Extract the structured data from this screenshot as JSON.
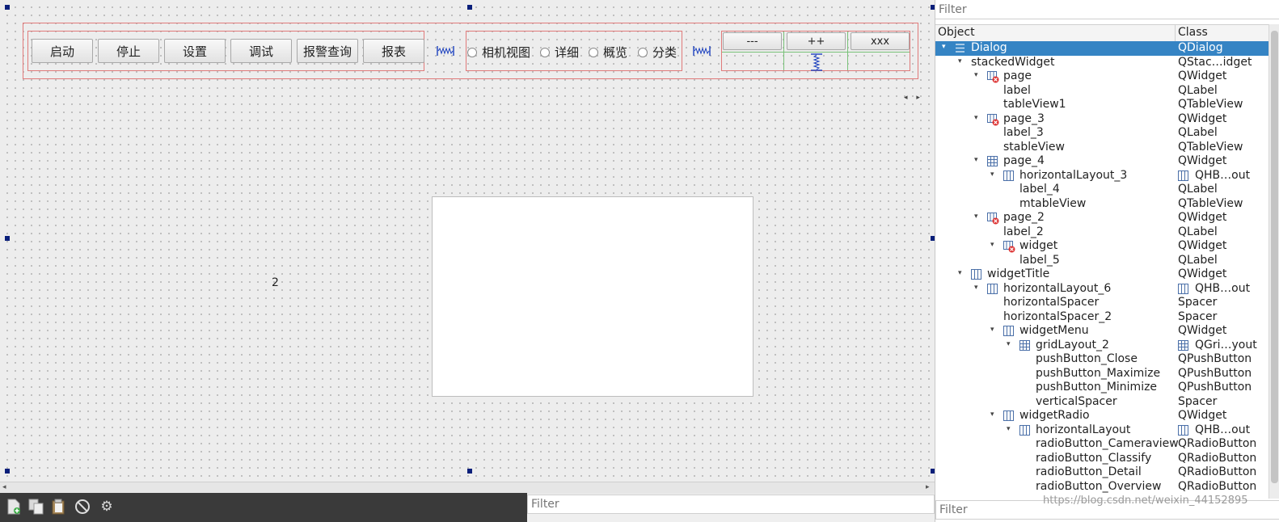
{
  "canvas": {
    "buttons": [
      "启动",
      "停止",
      "设置",
      "调试",
      "报警查询",
      "报表"
    ],
    "radios": [
      "相机视图",
      "详细",
      "概览",
      "分类"
    ],
    "window_buttons": [
      "---",
      "++",
      "xxx"
    ],
    "page_label": "2",
    "page_arrows": "◂ ▸"
  },
  "toolbar": {
    "icons": [
      "new-form-icon",
      "copy-icon",
      "paste-icon",
      "forbidden-icon",
      "gear-icon"
    ],
    "filter_placeholder": "Filter"
  },
  "inspector": {
    "filter_placeholder": "Filter",
    "bottom_filter_placeholder": "Filter",
    "header_object": "Object",
    "header_class": "Class",
    "rows": [
      {
        "name": "Dialog",
        "class": "QDialog",
        "level": 0,
        "expanded": true,
        "icon": "dialog-icon",
        "selected": true
      },
      {
        "name": "stackedWidget",
        "class": "QStac…idget",
        "level": 1,
        "expanded": true,
        "icon": ""
      },
      {
        "name": "page",
        "class": "QWidget",
        "level": 2,
        "expanded": true,
        "icon": "broken-layout-icon"
      },
      {
        "name": "label",
        "class": "QLabel",
        "level": 3,
        "icon": ""
      },
      {
        "name": "tableView1",
        "class": "QTableView",
        "level": 3,
        "icon": ""
      },
      {
        "name": "page_3",
        "class": "QWidget",
        "level": 2,
        "expanded": true,
        "icon": "broken-layout-icon"
      },
      {
        "name": "label_3",
        "class": "QLabel",
        "level": 3,
        "icon": ""
      },
      {
        "name": "stableView",
        "class": "QTableView",
        "level": 3,
        "icon": ""
      },
      {
        "name": "page_4",
        "class": "QWidget",
        "level": 2,
        "expanded": true,
        "icon": "grid-layout-icon"
      },
      {
        "name": "horizontalLayout_3",
        "class": "QHB…out",
        "level": 3,
        "expanded": true,
        "icon": "hbox-layout-icon",
        "class_icon": "hbox-layout-icon"
      },
      {
        "name": "label_4",
        "class": "QLabel",
        "level": 4,
        "icon": ""
      },
      {
        "name": "mtableView",
        "class": "QTableView",
        "level": 4,
        "icon": ""
      },
      {
        "name": "page_2",
        "class": "QWidget",
        "level": 2,
        "expanded": true,
        "icon": "broken-layout-icon"
      },
      {
        "name": "label_2",
        "class": "QLabel",
        "level": 3,
        "icon": ""
      },
      {
        "name": "widget",
        "class": "QWidget",
        "level": 3,
        "expanded": true,
        "icon": "broken-layout-icon"
      },
      {
        "name": "label_5",
        "class": "QLabel",
        "level": 4,
        "icon": ""
      },
      {
        "name": "widgetTitle",
        "class": "QWidget",
        "level": 1,
        "expanded": true,
        "icon": "hbox-layout-icon"
      },
      {
        "name": "horizontalLayout_6",
        "class": "QHB…out",
        "level": 2,
        "expanded": true,
        "icon": "hbox-layout-icon",
        "class_icon": "hbox-layout-icon"
      },
      {
        "name": "horizontalSpacer",
        "class": "Spacer",
        "level": 3,
        "icon": ""
      },
      {
        "name": "horizontalSpacer_2",
        "class": "Spacer",
        "level": 3,
        "icon": ""
      },
      {
        "name": "widgetMenu",
        "class": "QWidget",
        "level": 3,
        "expanded": true,
        "icon": "hbox-layout-icon"
      },
      {
        "name": "gridLayout_2",
        "class": "QGri…yout",
        "level": 4,
        "expanded": true,
        "icon": "grid-layout-icon",
        "class_icon": "grid-layout-icon"
      },
      {
        "name": "pushButton_Close",
        "class": "QPushButton",
        "level": 5,
        "icon": ""
      },
      {
        "name": "pushButton_Maximize",
        "class": "QPushButton",
        "level": 5,
        "icon": ""
      },
      {
        "name": "pushButton_Minimize",
        "class": "QPushButton",
        "level": 5,
        "icon": ""
      },
      {
        "name": "verticalSpacer",
        "class": "Spacer",
        "level": 5,
        "icon": ""
      },
      {
        "name": "widgetRadio",
        "class": "QWidget",
        "level": 3,
        "expanded": true,
        "icon": "hbox-layout-icon"
      },
      {
        "name": "horizontalLayout",
        "class": "QHB…out",
        "level": 4,
        "expanded": true,
        "icon": "hbox-layout-icon",
        "class_icon": "hbox-layout-icon"
      },
      {
        "name": "radioButton_Cameraview",
        "class": "QRadioButton",
        "level": 5,
        "icon": ""
      },
      {
        "name": "radioButton_Classify",
        "class": "QRadioButton",
        "level": 5,
        "icon": ""
      },
      {
        "name": "radioButton_Detail",
        "class": "QRadioButton",
        "level": 5,
        "icon": ""
      },
      {
        "name": "radioButton_Overview",
        "class": "QRadioButton",
        "level": 5,
        "icon": ""
      }
    ]
  },
  "watermark": "https://blog.csdn.net/weixin_44152895"
}
